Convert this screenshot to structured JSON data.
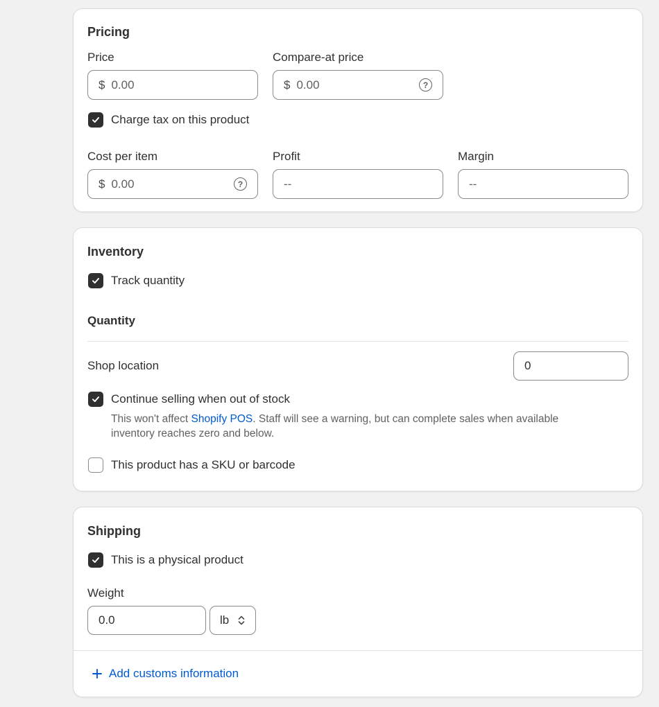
{
  "pricing": {
    "title": "Pricing",
    "price_label": "Price",
    "price_prefix": "$",
    "price_value": "0.00",
    "compare_label": "Compare-at price",
    "compare_prefix": "$",
    "compare_value": "0.00",
    "charge_tax_label": "Charge tax on this product",
    "charge_tax_checked": true,
    "cost_label": "Cost per item",
    "cost_prefix": "$",
    "cost_value": "0.00",
    "profit_label": "Profit",
    "profit_value": "--",
    "margin_label": "Margin",
    "margin_value": "--"
  },
  "inventory": {
    "title": "Inventory",
    "track_label": "Track quantity",
    "track_checked": true,
    "quantity_title": "Quantity",
    "location_label": "Shop location",
    "location_qty": "0",
    "continue_label": "Continue selling when out of stock",
    "continue_checked": true,
    "help_before": "This won't affect ",
    "help_link": "Shopify POS",
    "help_after": ". Staff will see a warning, but can complete sales when available",
    "help_line2": "inventory reaches zero and below.",
    "sku_label": "This product has a SKU or barcode",
    "sku_checked": false
  },
  "shipping": {
    "title": "Shipping",
    "physical_label": "This is a physical product",
    "physical_checked": true,
    "weight_label": "Weight",
    "weight_value": "0.0",
    "unit_value": "lb",
    "customs_label": "Add customs information"
  },
  "icons": {
    "help": "question-circle-icon",
    "check": "checkmark-icon",
    "plus": "plus-icon",
    "selector": "chevron-up-down-icon"
  },
  "colors": {
    "link": "#005bd3",
    "checkbox_checked": "#303030",
    "background": "#f1f1f1"
  }
}
